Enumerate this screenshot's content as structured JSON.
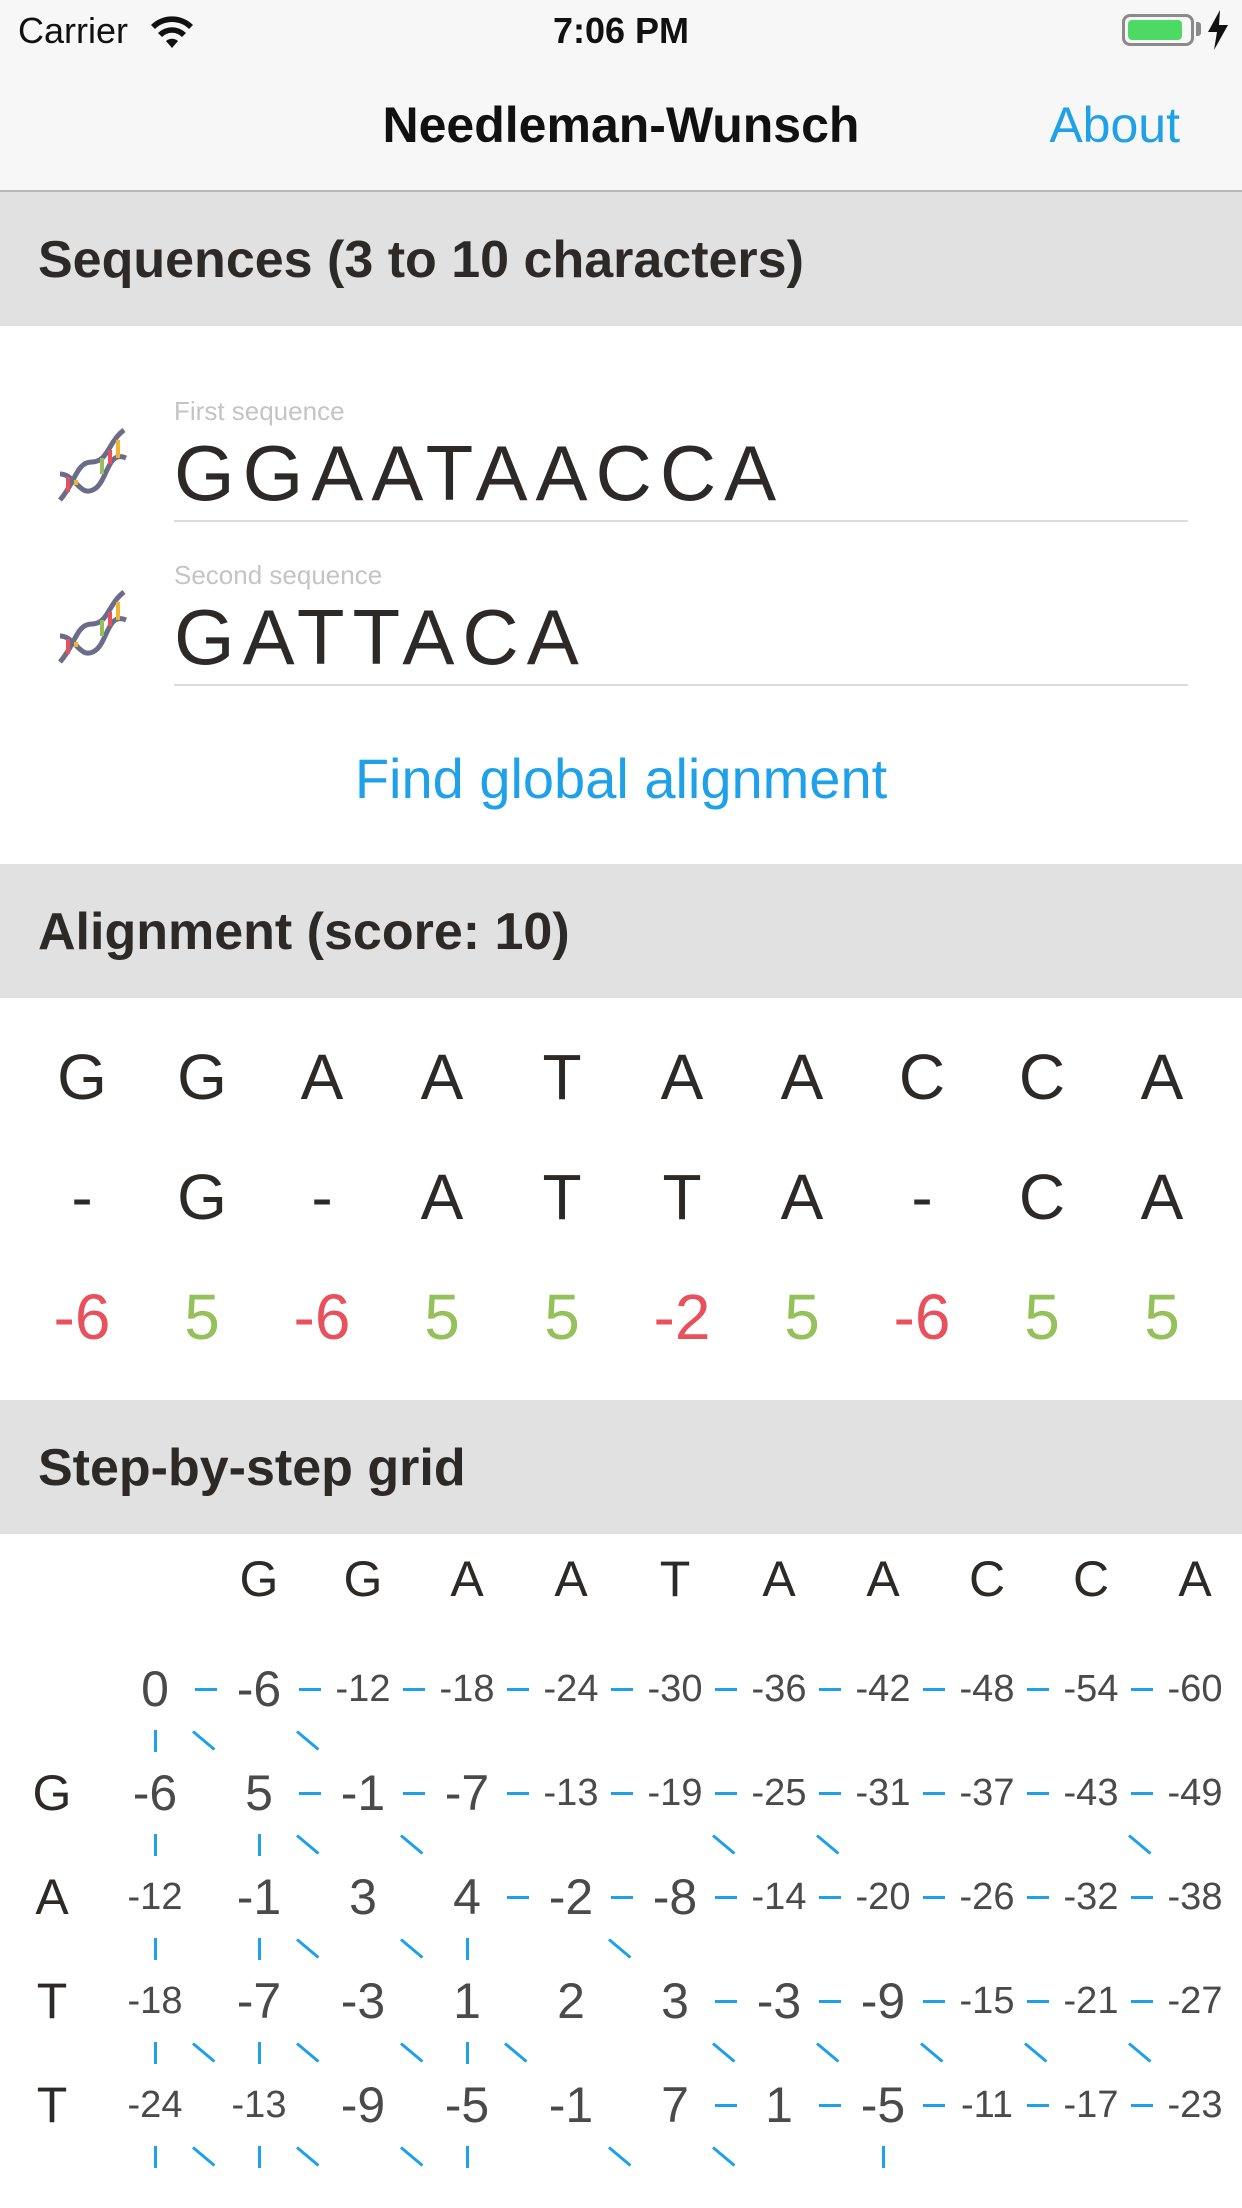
{
  "status_bar": {
    "carrier": "Carrier",
    "time": "7:06 PM",
    "battery_level": 0.9
  },
  "nav": {
    "title": "Needleman-Wunsch",
    "about": "About"
  },
  "sections": {
    "sequences": "Sequences (3 to 10 characters)",
    "alignment": "Alignment (score: 10)",
    "grid": "Step-by-step grid"
  },
  "inputs": {
    "first": {
      "label": "First sequence",
      "value": "GGAATAACCA"
    },
    "second": {
      "label": "Second sequence",
      "value": "GATTACA"
    }
  },
  "find_button": "Find global alignment",
  "alignment": {
    "top": [
      "G",
      "G",
      "A",
      "A",
      "T",
      "A",
      "A",
      "C",
      "C",
      "A"
    ],
    "bottom": [
      "-",
      "G",
      "-",
      "A",
      "T",
      "T",
      "A",
      "-",
      "C",
      "A"
    ],
    "scores": [
      "-6",
      "5",
      "-6",
      "5",
      "5",
      "-2",
      "5",
      "-6",
      "5",
      "5"
    ]
  },
  "grid": {
    "columns": [
      "G",
      "G",
      "A",
      "A",
      "T",
      "A",
      "A",
      "C",
      "C",
      "A"
    ],
    "row_labels": [
      "",
      "G",
      "A",
      "T",
      "T"
    ],
    "rows": [
      [
        "0",
        "-6",
        "-12",
        "-18",
        "-24",
        "-30",
        "-36",
        "-42",
        "-48",
        "-54",
        "-60"
      ],
      [
        "-6",
        "5",
        "-1",
        "-7",
        "-13",
        "-19",
        "-25",
        "-31",
        "-37",
        "-43",
        "-49"
      ],
      [
        "-12",
        "-1",
        "3",
        "4",
        "-2",
        "-8",
        "-14",
        "-20",
        "-26",
        "-32",
        "-38"
      ],
      [
        "-18",
        "-7",
        "-3",
        "1",
        "2",
        "3",
        "-3",
        "-9",
        "-15",
        "-21",
        "-27"
      ],
      [
        "-24",
        "-13",
        "-9",
        "-5",
        "-1",
        "7",
        "1",
        "-5",
        "-11",
        "-17",
        "-23"
      ]
    ],
    "h_arrows": [
      [
        1,
        1,
        1,
        1,
        1,
        1,
        1,
        1,
        1,
        1
      ],
      [
        0,
        1,
        1,
        1,
        1,
        1,
        1,
        1,
        1,
        1
      ],
      [
        0,
        0,
        0,
        1,
        1,
        1,
        1,
        1,
        1,
        1
      ],
      [
        0,
        0,
        0,
        0,
        0,
        1,
        1,
        1,
        1,
        1
      ],
      [
        0,
        0,
        0,
        0,
        0,
        1,
        1,
        1,
        1,
        1
      ]
    ],
    "v_arrows": [
      [
        1,
        0,
        0,
        0,
        0,
        0,
        0,
        0,
        0,
        0,
        0
      ],
      [
        1,
        1,
        0,
        0,
        0,
        0,
        0,
        0,
        0,
        0,
        0
      ],
      [
        1,
        1,
        0,
        1,
        0,
        0,
        0,
        0,
        0,
        0,
        0
      ],
      [
        1,
        1,
        0,
        1,
        0,
        0,
        0,
        0,
        0,
        0,
        0
      ],
      [
        1,
        1,
        0,
        1,
        0,
        0,
        0,
        1,
        0,
        0,
        0
      ]
    ],
    "d_arrows": [
      [
        1,
        1,
        0,
        0,
        0,
        0,
        0,
        0,
        0,
        0
      ],
      [
        0,
        1,
        1,
        0,
        0,
        1,
        1,
        0,
        0,
        1
      ],
      [
        0,
        1,
        1,
        0,
        1,
        0,
        0,
        0,
        0,
        0
      ],
      [
        1,
        1,
        1,
        1,
        0,
        1,
        1,
        1,
        1,
        1
      ],
      [
        1,
        1,
        1,
        0,
        1,
        1,
        0,
        0,
        0,
        0
      ]
    ]
  }
}
